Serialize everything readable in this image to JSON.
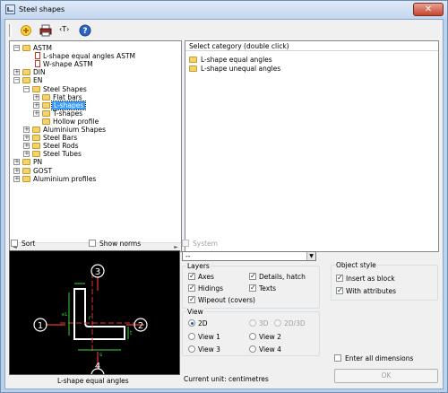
{
  "window": {
    "title": "Steel shapes",
    "close_glyph": "✕"
  },
  "toolbar": {
    "icons": [
      "add-icon",
      "print-icon",
      "text-tag-icon",
      "help-icon"
    ],
    "tag_text": "‹T›",
    "help_text": "?"
  },
  "tree": {
    "items": [
      {
        "label": "ASTM",
        "depth": 0,
        "expander": "−",
        "kind": "folder"
      },
      {
        "label": "L-shape equal angles ASTM",
        "depth": 1,
        "expander": "",
        "kind": "doc"
      },
      {
        "label": "W-shape ASTM",
        "depth": 1,
        "expander": "",
        "kind": "doc"
      },
      {
        "label": "DIN",
        "depth": 0,
        "expander": "+",
        "kind": "folder"
      },
      {
        "label": "EN",
        "depth": 0,
        "expander": "−",
        "kind": "folder"
      },
      {
        "label": "Steel Shapes",
        "depth": 1,
        "expander": "−",
        "kind": "folder"
      },
      {
        "label": "Flat bars",
        "depth": 2,
        "expander": "+",
        "kind": "folder"
      },
      {
        "label": "L-shapes",
        "depth": 2,
        "expander": "+",
        "kind": "folder",
        "selected": true
      },
      {
        "label": "T-shapes",
        "depth": 2,
        "expander": "+",
        "kind": "folder"
      },
      {
        "label": "Hollow profile",
        "depth": 2,
        "expander": "",
        "kind": "folder"
      },
      {
        "label": "Aluminium Shapes",
        "depth": 1,
        "expander": "+",
        "kind": "folder"
      },
      {
        "label": "Steel Bars",
        "depth": 1,
        "expander": "+",
        "kind": "folder"
      },
      {
        "label": "Steel Rods",
        "depth": 1,
        "expander": "+",
        "kind": "folder"
      },
      {
        "label": "Steel Tubes",
        "depth": 1,
        "expander": "+",
        "kind": "folder"
      },
      {
        "label": "PN",
        "depth": 0,
        "expander": "+",
        "kind": "folder"
      },
      {
        "label": "GOST",
        "depth": 0,
        "expander": "+",
        "kind": "folder"
      },
      {
        "label": "Aluminium profiles",
        "depth": 0,
        "expander": "+",
        "kind": "folder"
      }
    ],
    "scroll_left": "◄",
    "scroll_right": "►"
  },
  "category": {
    "header": "Select category (double click)",
    "items": [
      "L-shape equal angles",
      "L-shape unequal angles"
    ]
  },
  "options": {
    "sort": {
      "label": "Sort",
      "checked": false
    },
    "show_norms": {
      "label": "Show norms",
      "checked": false
    },
    "system": {
      "label": "System",
      "checked": false,
      "disabled": true
    }
  },
  "preview": {
    "caption": "L-shape equal angles",
    "labels": {
      "n1": "1",
      "n2": "2",
      "n3": "3",
      "n4": "4",
      "s": "s",
      "t": "t",
      "r": "r",
      "e1": "e1"
    }
  },
  "combo": {
    "value": "--",
    "arrow": "▼"
  },
  "layers": {
    "title": "Layers",
    "axes": {
      "label": "Axes",
      "checked": true
    },
    "details": {
      "label": "Details, hatch",
      "checked": true
    },
    "hidings": {
      "label": "Hidings",
      "checked": true
    },
    "texts": {
      "label": "Texts",
      "checked": true
    },
    "wipeout": {
      "label": "Wipeout (covers)",
      "checked": true
    }
  },
  "view": {
    "title": "View",
    "options": [
      "2D",
      "3D",
      "2D/3D",
      "View 1",
      "View 2",
      "View 3",
      "View 4"
    ],
    "selected": "2D"
  },
  "object_style": {
    "title": "Object style",
    "insert_block": {
      "label": "Insert as block",
      "checked": true
    },
    "with_attributes": {
      "label": "With attributes",
      "checked": true
    }
  },
  "enter_all": {
    "label": "Enter all dimensions",
    "checked": false
  },
  "current_unit": "Current unit: centimetres",
  "ok_label": "OK"
}
